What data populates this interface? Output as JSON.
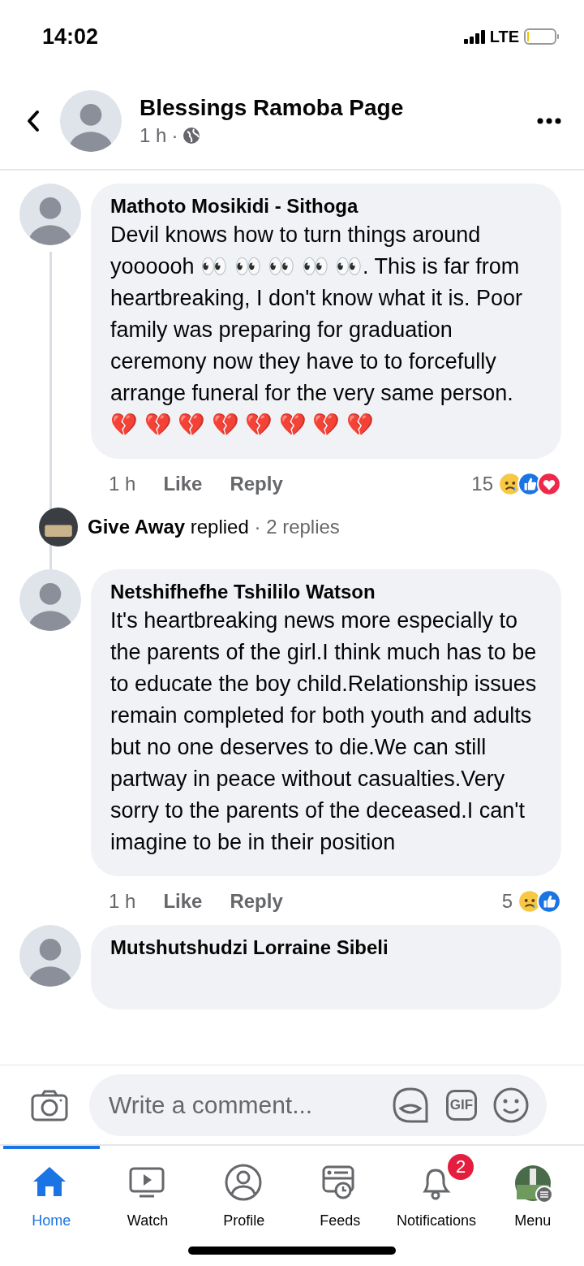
{
  "status_bar": {
    "time": "14:02",
    "network": "LTE"
  },
  "header": {
    "title": "Blessings Ramoba Page",
    "time": "1 h",
    "separator": "·"
  },
  "comments": [
    {
      "author": "Mathoto Mosikidi - Sithoga",
      "text": "Devil knows how to turn things around yoooooh 👀 👀 👀 👀 👀. This is far from heartbreaking, I don't know what it is. Poor family was preparing for graduation ceremony now they have to to forcefully arrange funeral for the very same person. 💔 💔 💔 💔 💔 💔 💔 💔",
      "time": "1 h",
      "actions": [
        "Like",
        "Reply"
      ],
      "reaction_count": "15",
      "reactions": [
        {
          "kind": "sad"
        },
        {
          "kind": "like"
        },
        {
          "kind": "love"
        }
      ],
      "thread": {
        "author": "Give Away",
        "verb": "replied",
        "separator": "·",
        "count": "2 replies"
      }
    },
    {
      "author": "Netshifhefhe Tshililo Watson",
      "text": "It's heartbreaking news more especially to the parents of the girl.I think much has to be to educate the boy child.Relationship issues remain completed for both youth and adults but no one deserves to die.We can still partway in peace without casualties.Very sorry to the parents of the deceased.I can't imagine to be in their position",
      "time": "1 h",
      "actions": [
        "Like",
        "Reply"
      ],
      "reaction_count": "5",
      "reactions": [
        {
          "kind": "sad"
        },
        {
          "kind": "like"
        }
      ]
    },
    {
      "author": "Mutshutshudzi Lorraine Sibeli"
    }
  ],
  "composer": {
    "placeholder": "Write a comment...",
    "gif_label": "GIF"
  },
  "nav": [
    {
      "kind": "home",
      "label": "Home",
      "selected": true
    },
    {
      "kind": "watch",
      "label": "Watch",
      "selected": false
    },
    {
      "kind": "profile",
      "label": "Profile",
      "selected": false
    },
    {
      "kind": "feeds",
      "label": "Feeds",
      "selected": false
    },
    {
      "kind": "notifications",
      "label": "Notifications",
      "selected": false,
      "badge": "2"
    },
    {
      "kind": "menu",
      "label": "Menu",
      "selected": false
    }
  ]
}
